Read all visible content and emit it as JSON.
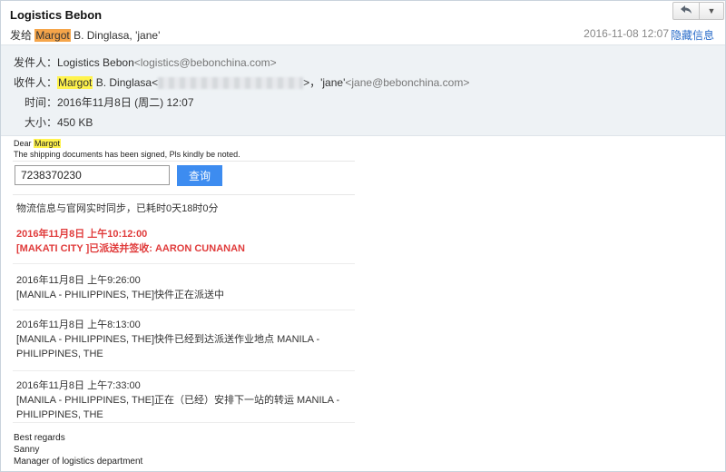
{
  "header": {
    "subject": "Logistics Bebon",
    "send_prefix": "发给",
    "recipient_highlight": "Margot",
    "recipient_rest": "B. Dinglasa, 'jane'",
    "datetime": "2016-11-08 12:07",
    "hide_label": "隐藏信息",
    "reply_icon": "reply-arrow",
    "more_icon": "triangle-down"
  },
  "details": {
    "from_label": "发件人：",
    "from_name": "Logistics Bebon",
    "from_email": "<logistics@bebonchina.com>",
    "to_label": "收件人：",
    "to_highlight": "Margot",
    "to_name_rest": "B. Dinglasa<",
    "to_after_blur": ">，'jane'",
    "to_email2": "<jane@bebonchina.com>",
    "time_label": "时间：",
    "time_value": "2016年11月8日 (周二) 12:07",
    "size_label": "大小：",
    "size_value": "450 KB"
  },
  "body": {
    "dear": "Dear",
    "dear_name": "Margot",
    "message": "The shipping documents has been signed, Pls kindly be noted.",
    "tracking_number": "7238370230",
    "query_button": "查询",
    "sync_text": "物流信息与官网实时同步，已耗时0天18时0分",
    "events": [
      {
        "time": "2016年11月8日 上午10:12:00",
        "text": "[MAKATI CITY ]已派送并签收: AARON CUNANAN"
      },
      {
        "time": "2016年11月8日 上午9:26:00",
        "text": "[MANILA - PHILIPPINES, THE]快件正在派送中"
      },
      {
        "time": "2016年11月8日 上午8:13:00",
        "text": "[MANILA - PHILIPPINES, THE]快件已经到达派送作业地点 MANILA - PHILIPPINES, THE"
      },
      {
        "time": "2016年11月8日 上午7:33:00",
        "text": "[MANILA - PHILIPPINES, THE]正在（已经）安排下一站的转运 MANILA - PHILIPPINES, THE"
      }
    ]
  },
  "signature": {
    "regards": "Best regards",
    "name": "Sanny",
    "title": "Manager of logistics department"
  },
  "colors": {
    "accent_blue": "#3d8cf0",
    "link_blue": "#2a6cc9",
    "highlight_orange": "#f5a54a",
    "highlight_yellow": "#fff34d",
    "delivered_red": "#e03b3b",
    "details_bg": "#eef2f5"
  }
}
